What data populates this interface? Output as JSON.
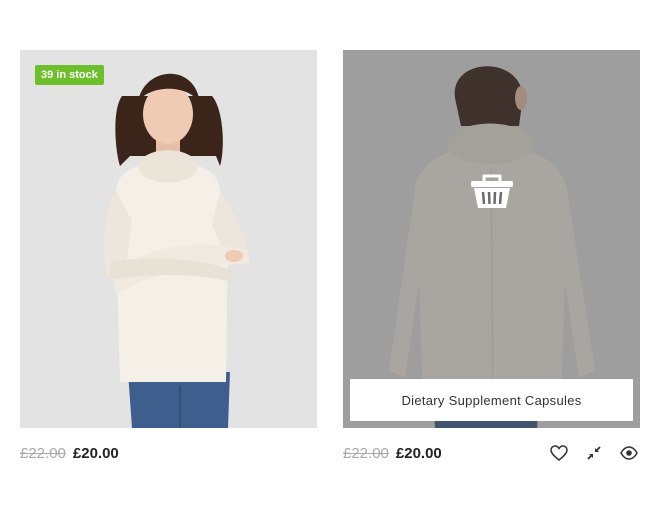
{
  "products": [
    {
      "stock_badge": "39 in stock",
      "price_old": "£22.00",
      "price_new": "£20.00"
    },
    {
      "add_to_cart_label": "Dietary Supplement Capsules",
      "price_old": "£22.00",
      "price_new": "£20.00",
      "actions": {
        "wishlist_icon": "heart-icon",
        "compare_icon": "compare-icon",
        "quickview_icon": "eye-icon"
      }
    }
  ],
  "colors": {
    "badge_green": "#6dbf2c",
    "price_old": "#a9a9a9",
    "price_new": "#222222"
  }
}
